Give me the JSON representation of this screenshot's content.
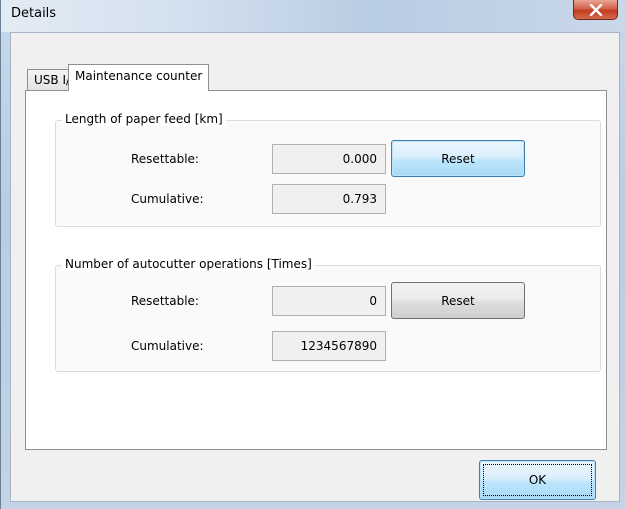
{
  "window": {
    "title": "Details",
    "close_icon": "close-icon"
  },
  "tabs": [
    {
      "label": "USB I/F",
      "active": false
    },
    {
      "label": "Maintenance counter",
      "active": true
    }
  ],
  "paper_feed": {
    "title": "Length of paper feed [km]",
    "resettable_label": "Resettable:",
    "resettable_value": "0.000",
    "cumulative_label": "Cumulative:",
    "cumulative_value": "0.793",
    "reset_label": "Reset"
  },
  "autocutter": {
    "title": "Number of autocutter operations [Times]",
    "resettable_label": "Resettable:",
    "resettable_value": "0",
    "cumulative_label": "Cumulative:",
    "cumulative_value": "1234567890",
    "reset_label": "Reset"
  },
  "ok_label": "OK",
  "colors": {
    "close_button": "#c23b1f",
    "focus_button": "#3c7fb1"
  }
}
